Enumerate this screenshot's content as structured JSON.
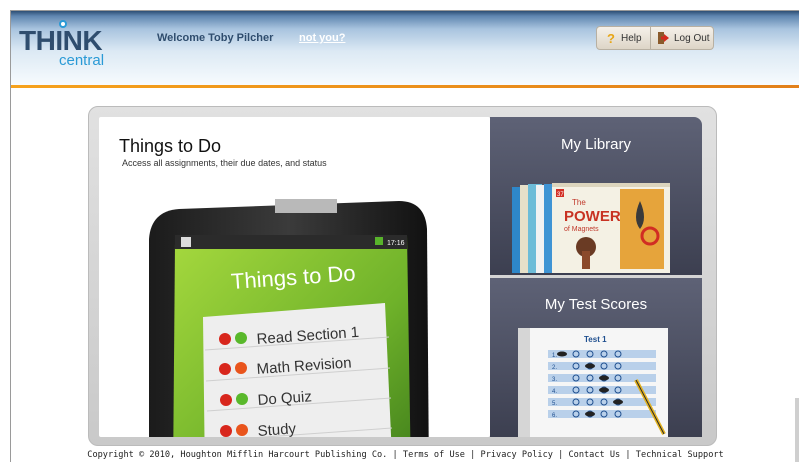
{
  "header": {
    "logo_think": "THINK",
    "logo_central": "central",
    "welcome": "Welcome Toby Pilcher",
    "not_you": "not you?",
    "help_label": "Help",
    "logout_label": "Log Out"
  },
  "todo": {
    "title": "Things to Do",
    "subtitle": "Access all assignments, their due dates, and status",
    "screen_title": "Things to Do",
    "clock": "17:16",
    "items": [
      "Read Section 1",
      "Math Revision",
      "Do Quiz",
      "Study"
    ]
  },
  "library": {
    "title": "My Library",
    "book_line1": "The",
    "book_line2": "POWER",
    "book_line3": "of Magnets",
    "badge": "37"
  },
  "scores": {
    "title": "My Test Scores",
    "sheet_title": "Test 1",
    "rows": [
      "1.",
      "2.",
      "3.",
      "4.",
      "5.",
      "6."
    ]
  },
  "footer": {
    "copyright": "Copyright © 2010, Houghton Mifflin Harcourt Publishing Co.",
    "sep": " | ",
    "terms": "Terms of Use",
    "privacy": "Privacy Policy",
    "contact": "Contact Us",
    "support": "Technical Support"
  },
  "colors": {
    "brand_navy": "#2f4d6e",
    "brand_blue": "#2a9ad6",
    "accent_orange": "#f6a21d",
    "device_green": "#7ec12f",
    "tile_dark": "#3c3f50"
  }
}
